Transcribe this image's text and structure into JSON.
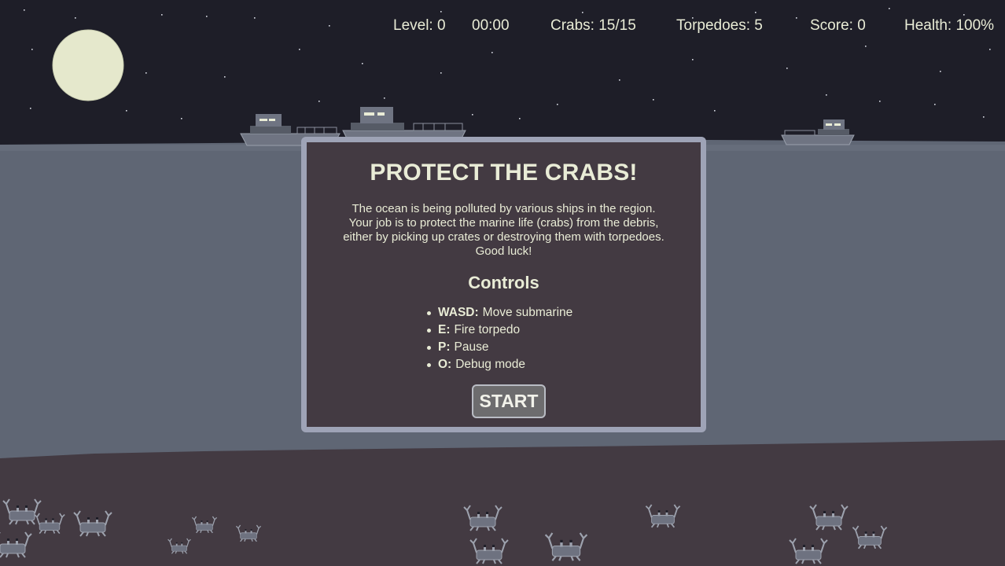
{
  "hud": {
    "level": "Level: 0",
    "timer": "00:00",
    "crabs": "Crabs: 15/15",
    "torpedoes": "Torpedoes: 5",
    "score": "Score: 0",
    "health": "Health: 100%"
  },
  "dialog": {
    "title": "PROTECT THE CRABS!",
    "intro_lines": [
      "The ocean is being polluted by various ships in the region.",
      "Your job is to protect the marine life (crabs) from the debris,",
      "either by picking up crates or destroying them with torpedoes.",
      "Good luck!"
    ],
    "controls_title": "Controls",
    "controls": [
      {
        "key": "WASD:",
        "action": "Move submarine"
      },
      {
        "key": "E:",
        "action": "Fire torpedo"
      },
      {
        "key": "P:",
        "action": "Pause"
      },
      {
        "key": "O:",
        "action": "Debug mode"
      }
    ],
    "start_label": "START"
  },
  "colors": {
    "sky": "#1e1e28",
    "ocean": "#606775",
    "seabed": "#433a42",
    "moon": "#e5e8cc",
    "text": "#e9ecd6",
    "ship": "#7a7f8c",
    "crab": "#6e7280"
  },
  "scene": {
    "ship_count": 3,
    "crab_count": 15
  }
}
